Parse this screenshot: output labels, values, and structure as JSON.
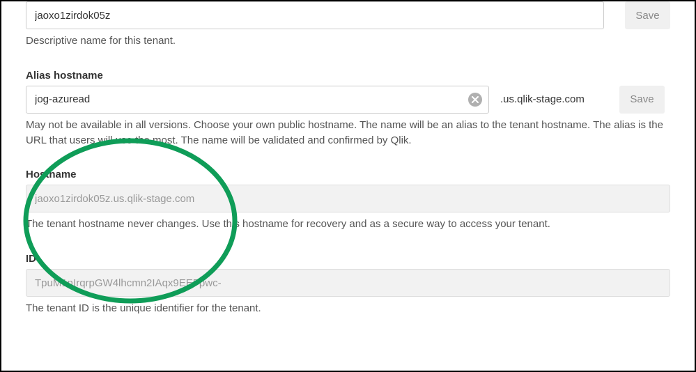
{
  "name_field": {
    "value": "jaoxo1zirdok05z",
    "save_label": "Save",
    "help": "Descriptive name for this tenant."
  },
  "alias_field": {
    "label": "Alias hostname",
    "value": "jog-azuread",
    "suffix": ".us.qlik-stage.com",
    "save_label": "Save",
    "help": "May not be available in all versions. Choose your own public hostname. The name will be an alias to the tenant hostname. The alias is the URL that users will use the most. The name will be validated and confirmed by Qlik."
  },
  "hostname_field": {
    "label": "Hostname",
    "value": "jaoxo1zirdok05z.us.qlik-stage.com",
    "help": "The tenant hostname never changes. Use this hostname for recovery and as a secure way to access your tenant."
  },
  "id_field": {
    "label": "ID",
    "value": "TpuM1nIrqrpGW4lhcmn2IAqx9EEFpwc-",
    "help": "The tenant ID is the unique identifier for the tenant."
  },
  "icons": {
    "clear": "close-circle-icon"
  },
  "annotation": {
    "color": "#0f9d58"
  }
}
